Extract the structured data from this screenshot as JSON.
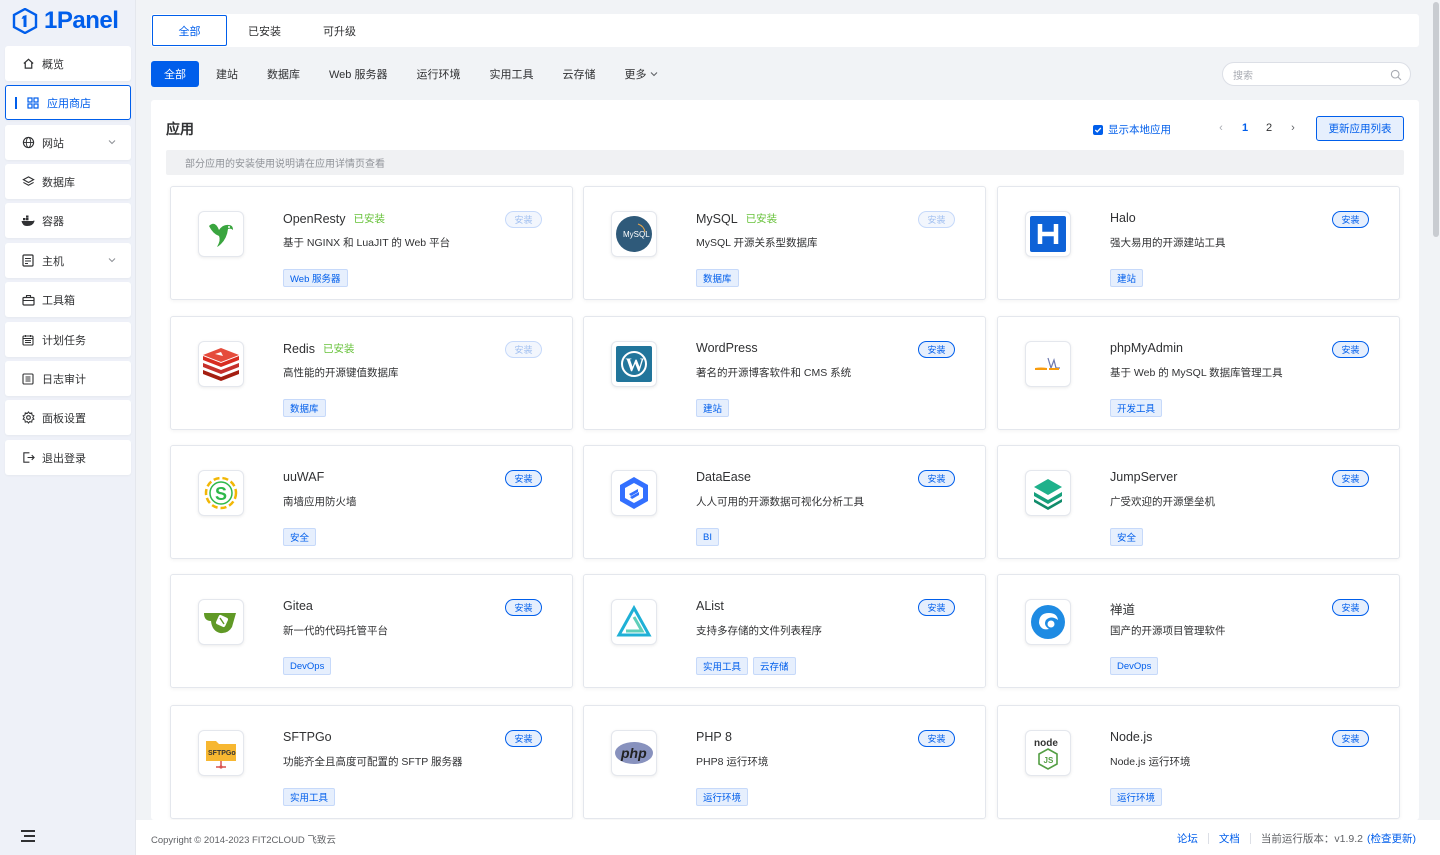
{
  "brand": {
    "name": "1Panel",
    "color": "#005eeb"
  },
  "sidebar": {
    "items": [
      {
        "label": "概览",
        "icon": "home-icon"
      },
      {
        "label": "应用商店",
        "icon": "grid-icon"
      },
      {
        "label": "网站",
        "icon": "globe-icon"
      },
      {
        "label": "数据库",
        "icon": "layers-icon"
      },
      {
        "label": "容器",
        "icon": "docker-icon"
      },
      {
        "label": "主机",
        "icon": "host-icon"
      },
      {
        "label": "工具箱",
        "icon": "toolbox-icon"
      },
      {
        "label": "计划任务",
        "icon": "calendar-icon"
      },
      {
        "label": "日志审计",
        "icon": "log-icon"
      },
      {
        "label": "面板设置",
        "icon": "gear-icon"
      },
      {
        "label": "退出登录",
        "icon": "logout-icon"
      }
    ]
  },
  "top_tabs": [
    "全部",
    "已安装",
    "可升级"
  ],
  "categories": [
    "全部",
    "建站",
    "数据库",
    "Web 服务器",
    "运行环境",
    "实用工具",
    "云存储",
    "更多"
  ],
  "search": {
    "placeholder": "搜索"
  },
  "panel": {
    "title": "应用",
    "show_local": "显示本地应用",
    "pages": [
      "1",
      "2"
    ],
    "refresh": "更新应用列表",
    "notice": "部分应用的安装使用说明请在应用详情页查看"
  },
  "install_label": "安装",
  "installed_label": "已安装",
  "apps": [
    {
      "name": "OpenResty",
      "installed": true,
      "desc": "基于 NGINX 和 LuaJIT 的 Web 平台",
      "tags": [
        "Web 服务器"
      ],
      "icon": "openresty-icon"
    },
    {
      "name": "MySQL",
      "installed": true,
      "desc": "MySQL 开源关系型数据库",
      "tags": [
        "数据库"
      ],
      "icon": "mysql-icon"
    },
    {
      "name": "Halo",
      "installed": false,
      "desc": "强大易用的开源建站工具",
      "tags": [
        "建站"
      ],
      "icon": "halo-icon"
    },
    {
      "name": "Redis",
      "installed": true,
      "desc": "高性能的开源键值数据库",
      "tags": [
        "数据库"
      ],
      "icon": "redis-icon"
    },
    {
      "name": "WordPress",
      "installed": false,
      "desc": "著名的开源博客软件和 CMS 系统",
      "tags": [
        "建站"
      ],
      "icon": "wordpress-icon"
    },
    {
      "name": "phpMyAdmin",
      "installed": false,
      "desc": "基于 Web 的 MySQL 数据库管理工具",
      "tags": [
        "开发工具"
      ],
      "icon": "phpmyadmin-icon"
    },
    {
      "name": "uuWAF",
      "installed": false,
      "desc": "南墙应用防火墙",
      "tags": [
        "安全"
      ],
      "icon": "uuwaf-icon"
    },
    {
      "name": "DataEase",
      "installed": false,
      "desc": "人人可用的开源数据可视化分析工具",
      "tags": [
        "BI"
      ],
      "icon": "dataease-icon"
    },
    {
      "name": "JumpServer",
      "installed": false,
      "desc": "广受欢迎的开源堡垒机",
      "tags": [
        "安全"
      ],
      "icon": "jumpserver-icon"
    },
    {
      "name": "Gitea",
      "installed": false,
      "desc": "新一代的代码托管平台",
      "tags": [
        "DevOps"
      ],
      "icon": "gitea-icon"
    },
    {
      "name": "AList",
      "installed": false,
      "desc": "支持多存储的文件列表程序",
      "tags": [
        "实用工具",
        "云存储"
      ],
      "icon": "alist-icon"
    },
    {
      "name": "禅道",
      "installed": false,
      "desc": "国产的开源项目管理软件",
      "tags": [
        "DevOps"
      ],
      "icon": "zentao-icon"
    },
    {
      "name": "SFTPGo",
      "installed": false,
      "desc": "功能齐全且高度可配置的 SFTP 服务器",
      "tags": [
        "实用工具"
      ],
      "icon": "sftpgo-icon"
    },
    {
      "name": "PHP 8",
      "installed": false,
      "desc": "PHP8 运行环境",
      "tags": [
        "运行环境"
      ],
      "icon": "php-icon"
    },
    {
      "name": "Node.js",
      "installed": false,
      "desc": "Node.js 运行环境",
      "tags": [
        "运行环境"
      ],
      "icon": "nodejs-icon"
    }
  ],
  "footer": {
    "copyright": "Copyright © 2014-2023 FIT2CLOUD 飞致云",
    "forum": "论坛",
    "docs": "文档",
    "version_label": "当前运行版本：v1.9.2",
    "check_update": "(检查更新)"
  }
}
